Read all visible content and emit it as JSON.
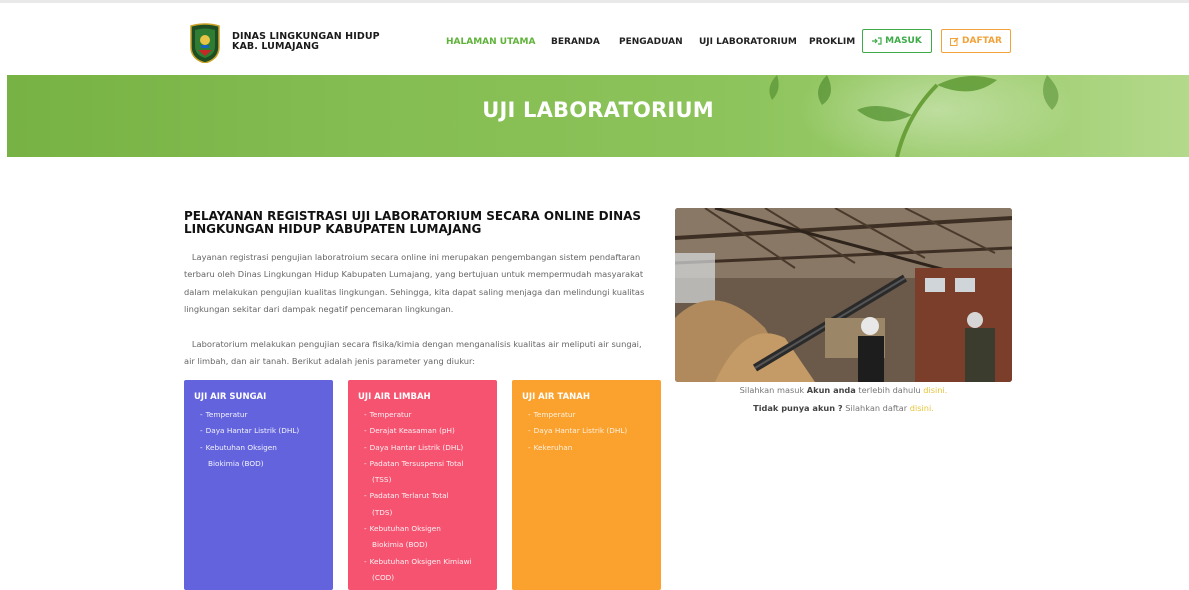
{
  "header": {
    "brand_line1": "DINAS LINGKUNGAN HIDUP",
    "brand_line2": "KAB. LUMAJANG",
    "nav": [
      "HALAMAN UTAMA",
      "BERANDA",
      "PENGADUAN",
      "UJI LABORATORIUM",
      "PROKLIM"
    ],
    "login_label": "MASUK",
    "register_label": "DAFTAR",
    "active_color": "#5fb33a",
    "icons": {
      "login": "sign-in-icon",
      "register": "edit-icon"
    }
  },
  "banner": {
    "title": "UJI LABORATORIUM"
  },
  "main": {
    "title": "PELAYANAN REGISTRASI UJI LABORATORIUM SECARA ONLINE DINAS LINGKUNGAN HIDUP KABUPATEN LUMAJANG",
    "paragraph1": "Layanan registrasi pengujian laboratroium secara online ini merupakan pengembangan sistem pendaftaran terbaru oleh Dinas Lingkungan Hidup Kabupaten Lumajang, yang bertujuan untuk mempermudah masyarakat dalam melakukan pengujian kualitas lingkungan. Sehingga, kita dapat saling menjaga dan melindungi kualitas lingkungan sekitar dari dampak negatif pencemaran lingkungan.",
    "paragraph2": "Laboratorium melakukan pengujian secara fisika/kimia dengan menganalisis kualitas air meliputi air sungai, air limbah, dan air tanah. Berikut adalah jenis parameter yang diukur:"
  },
  "cards": [
    {
      "title": "UJI AIR SUNGAI",
      "color": "#6363dd",
      "items": [
        "Temperatur",
        "Daya Hantar Listrik (DHL)",
        "Kebutuhan Oksigen",
        "Biokimia (BOD)"
      ]
    },
    {
      "title": "UJI AIR LIMBAH",
      "color": "#f55370",
      "items": [
        "Temperatur",
        "Derajat Keasaman (pH)",
        "Daya Hantar Listrik (DHL)",
        "Padatan Tersuspensi Total",
        "(TSS)",
        "Padatan Terlarut Total",
        "(TDS)",
        "Kebutuhan Oksigen",
        "Biokimia (BOD)",
        "Kebutuhan Oksigen Kimiawi",
        "(COD)"
      ]
    },
    {
      "title": "UJI AIR TANAH",
      "color": "#fba12d",
      "items": [
        "Temperatur",
        "Daya Hantar Listrik (DHL)",
        "Kekeruhan"
      ]
    }
  ],
  "sidebar": {
    "login_pre": "Silahkan masuk",
    "login_bold": "Akun anda",
    "login_mid": "terlebih dahulu",
    "login_link": "disini.",
    "register_bold": "Tidak punya akun ?",
    "register_mid": "Silahkan daftar",
    "register_link": "disini."
  }
}
